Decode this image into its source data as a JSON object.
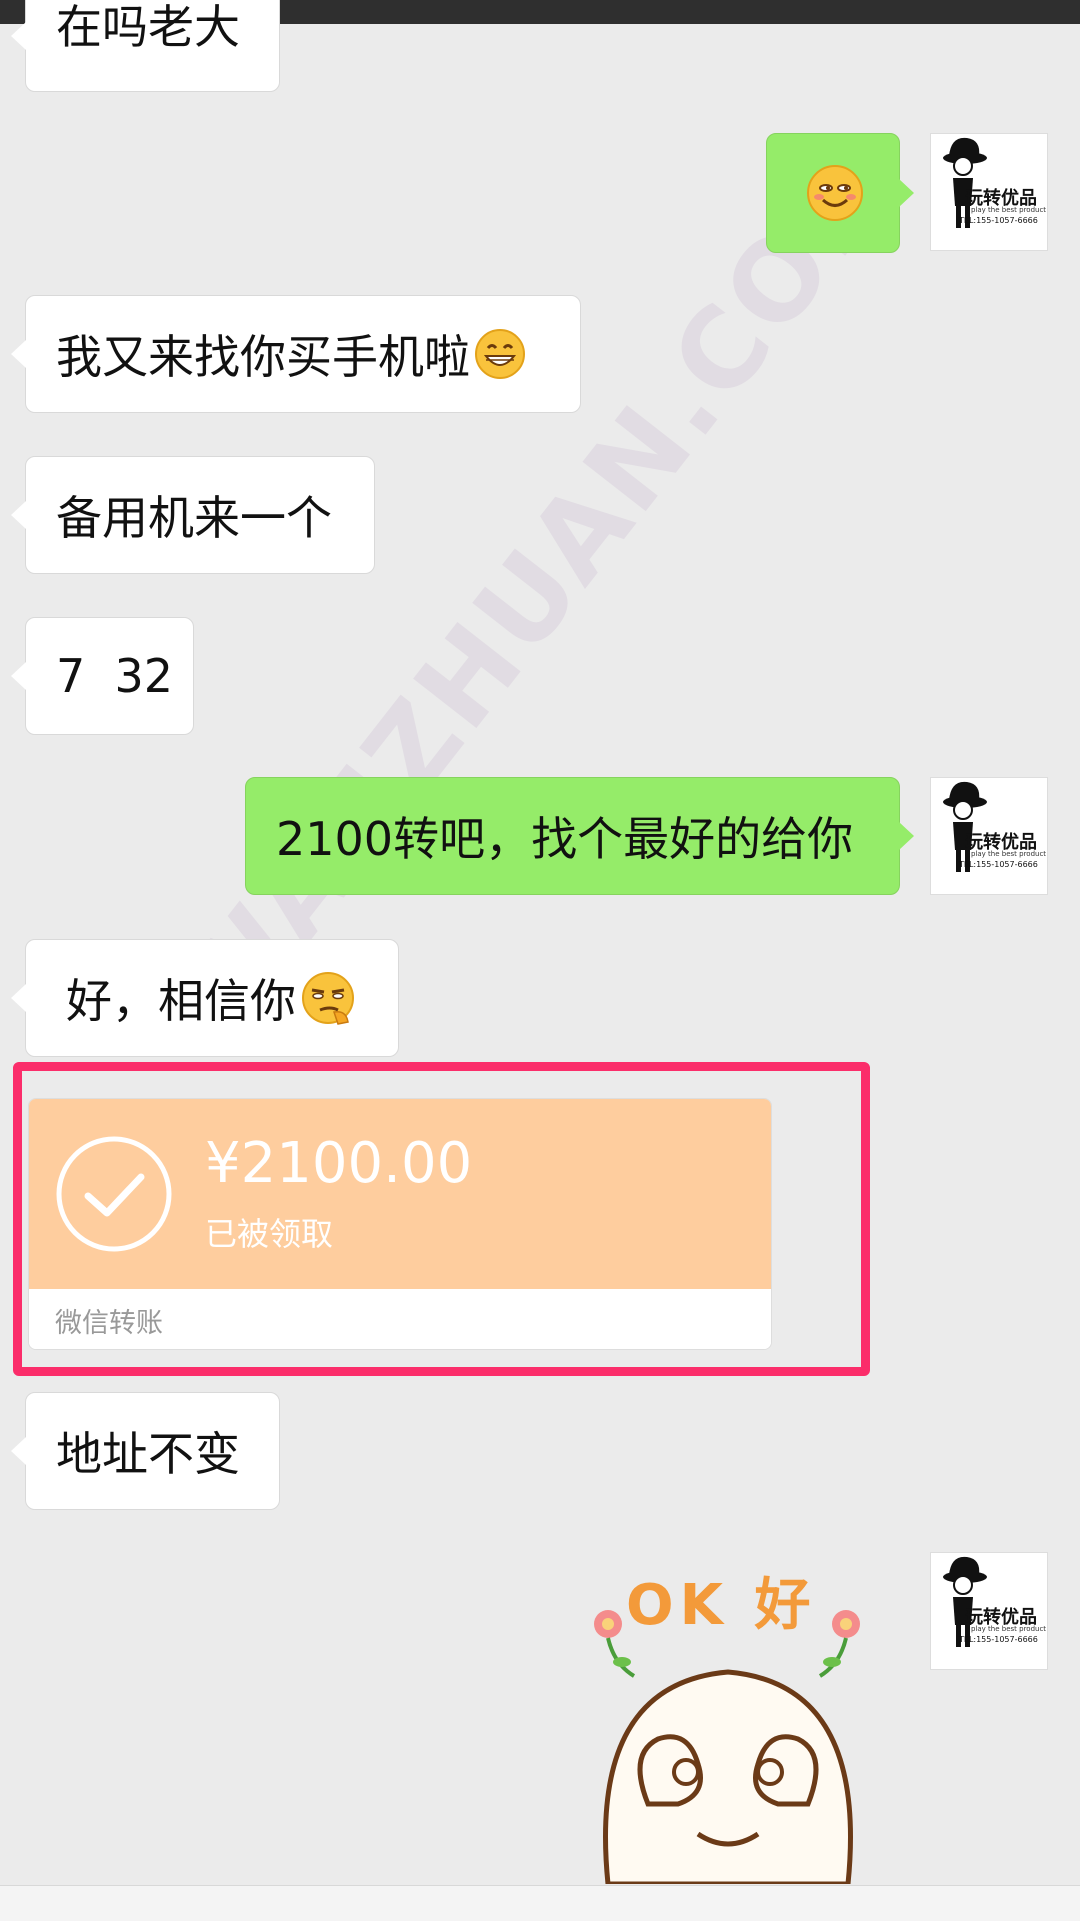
{
  "messages": {
    "partial_top": "在吗老大",
    "buy_phone": "我又来找你买手机啦",
    "backup_phone": "备用机来一个",
    "spec": "7  32",
    "reply_price": "2100转吧，找个最好的给你",
    "trust": "好，相信你",
    "address": "地址不变"
  },
  "transfer": {
    "amount": "¥2100.00",
    "status": "已被领取",
    "label": "微信转账"
  },
  "avatar": {
    "brand": "玩转优品",
    "tagline": "play the best product",
    "tel": "TEL:155-1057-6666"
  },
  "sticker": {
    "text": "OK 好"
  },
  "watermark": "WANZHUAN.COM",
  "colors": {
    "left_bubble": "#ffffff",
    "right_bubble": "#95ec69",
    "transfer_card": "#fecd9e",
    "highlight_border": "#fb2d6a",
    "background": "#ebebeb"
  },
  "icons": [
    "smile-emoji-icon",
    "grin-emoji-icon",
    "smirk-emoji-icon",
    "check-circle-icon",
    "ok-sticker-icon"
  ]
}
